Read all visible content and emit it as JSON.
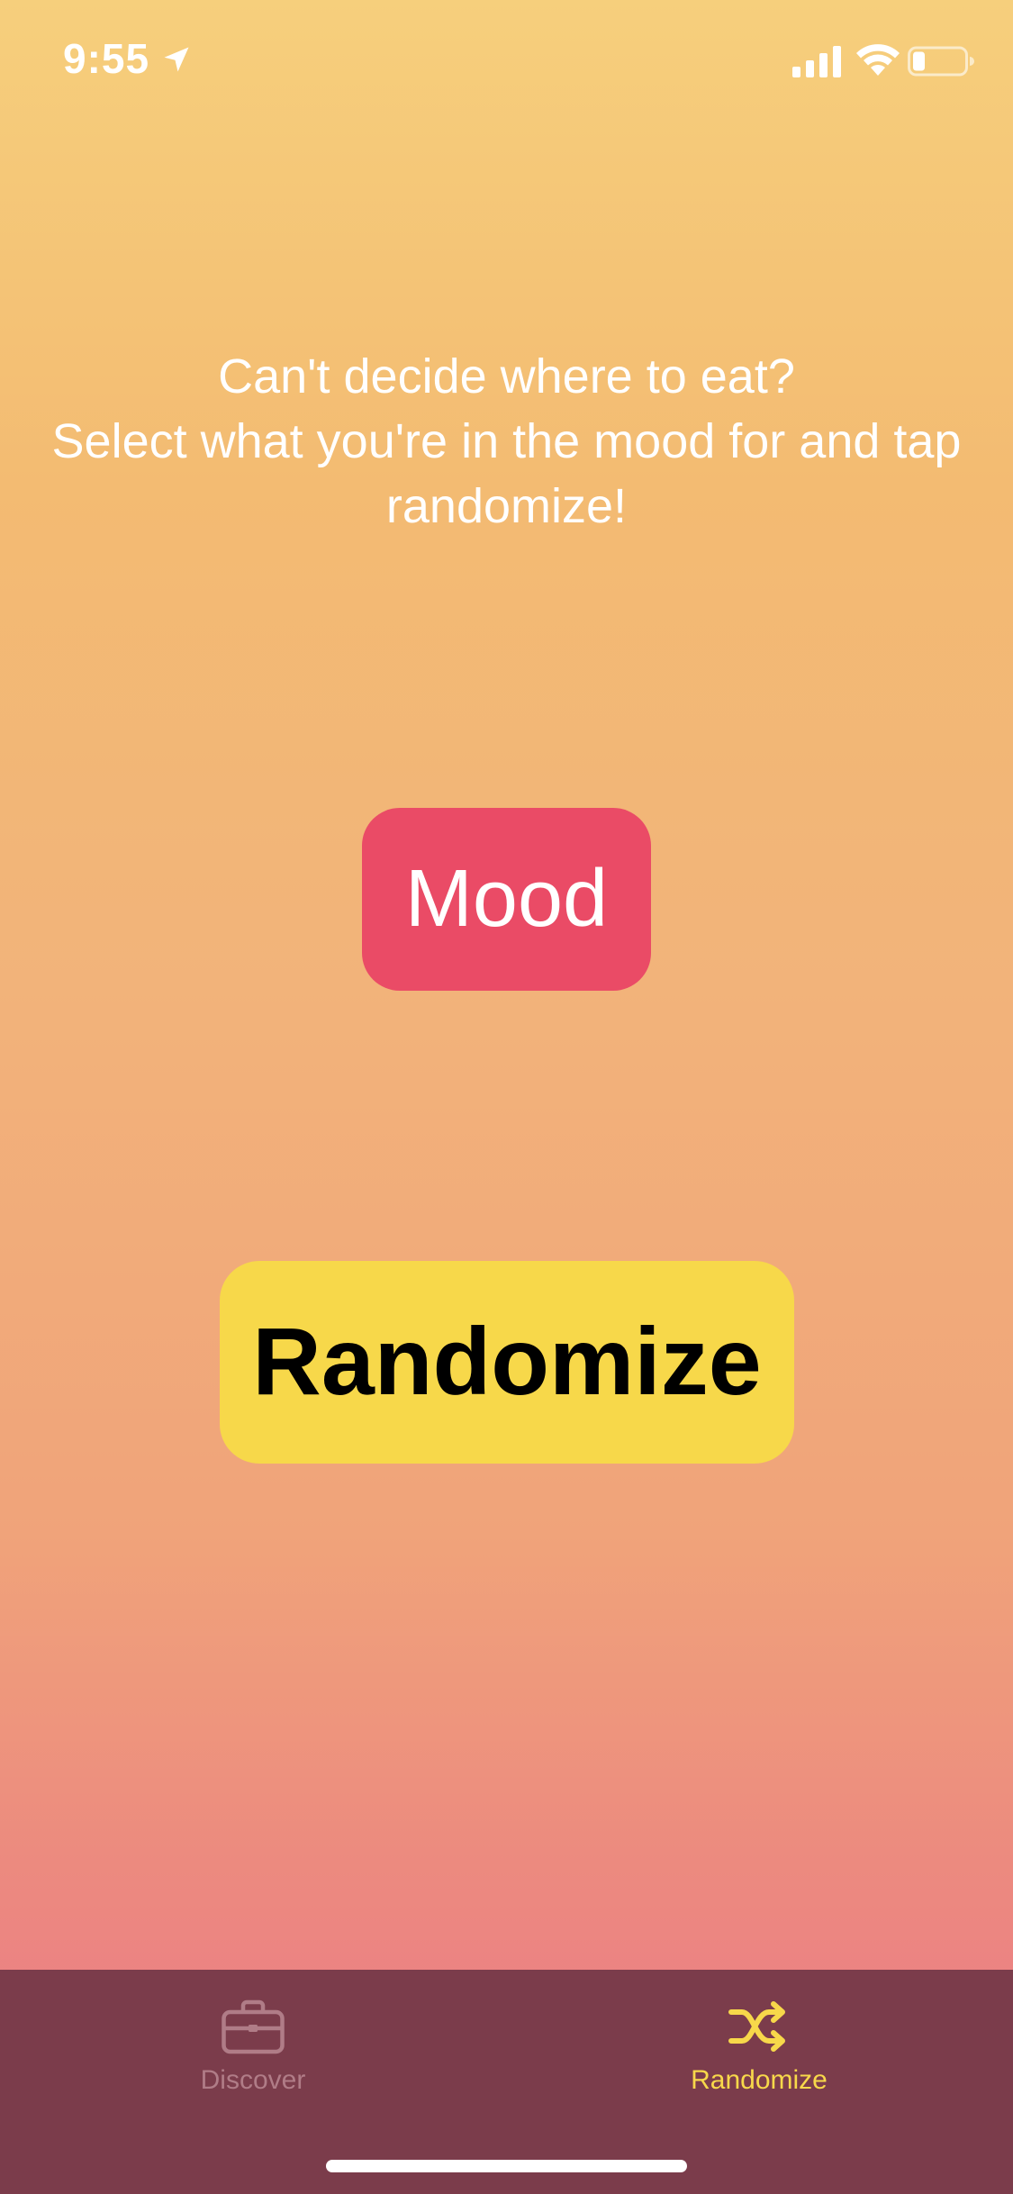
{
  "status_bar": {
    "time": "9:55",
    "icons": [
      "location-arrow-icon",
      "cellular-signal-icon",
      "wifi-icon",
      "battery-icon"
    ]
  },
  "instructions": {
    "line1": "Can't decide where to eat?",
    "line2": "Select what you're in the mood for and tap",
    "line3": "randomize!"
  },
  "buttons": {
    "mood_label": "Mood",
    "randomize_label": "Randomize"
  },
  "tab_bar": {
    "tabs": [
      {
        "label": "Discover",
        "icon": "briefcase-icon",
        "selected": false
      },
      {
        "label": "Randomize",
        "icon": "shuffle-icon",
        "selected": true
      }
    ]
  },
  "colors": {
    "mood_button": "#ea4b66",
    "randomize_button": "#f7d84a",
    "tab_bar": "#7b3c4b",
    "tab_active": "#f7d84a",
    "tab_inactive": "#b07c87",
    "gradient_top": "#f6cf7c",
    "gradient_bottom": "#ea7689"
  }
}
